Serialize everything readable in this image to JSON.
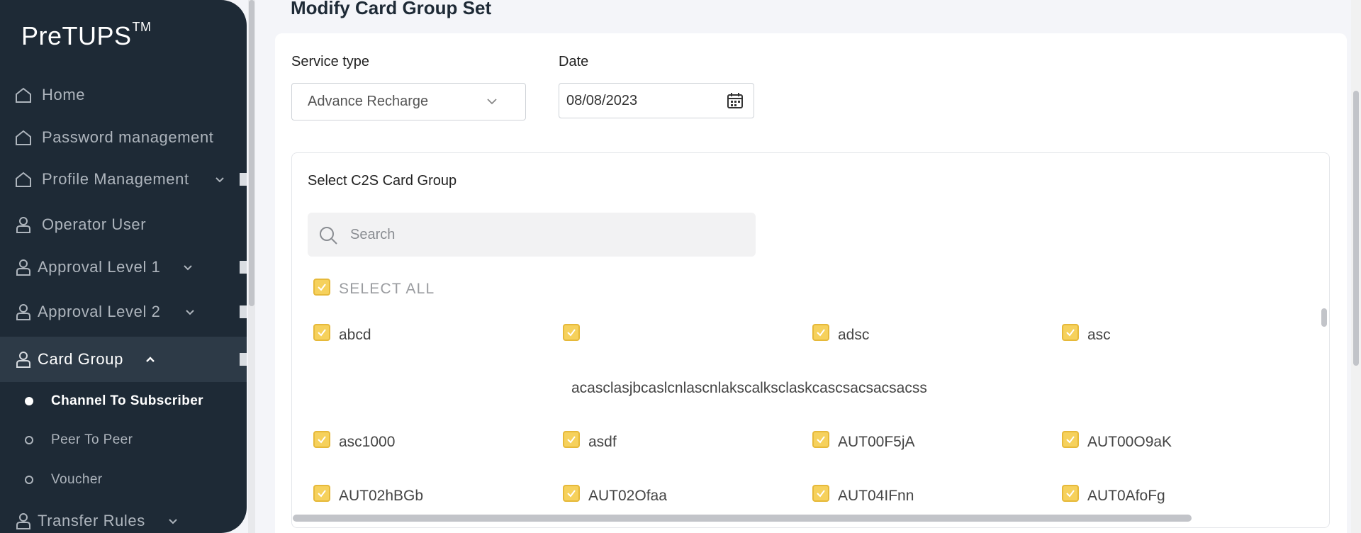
{
  "brand": {
    "name": "PreTUPS",
    "trademark": "TM"
  },
  "sidebar": {
    "items": [
      {
        "label": "Home",
        "icon": "home-icon"
      },
      {
        "label": "Password management",
        "icon": "home-icon"
      },
      {
        "label": "Profile Management",
        "icon": "home-icon"
      },
      {
        "label": "Operator User",
        "icon": "user-icon"
      },
      {
        "label": "Approval Level 1",
        "icon": "user-icon"
      },
      {
        "label": "Approval Level 2",
        "icon": "user-icon"
      },
      {
        "label": "Card Group",
        "icon": "user-icon"
      },
      {
        "label": "Transfer Rules",
        "icon": "user-icon"
      }
    ],
    "sub_items": [
      {
        "label": "Channel To Subscriber"
      },
      {
        "label": "Peer To Peer"
      },
      {
        "label": "Voucher"
      }
    ]
  },
  "page": {
    "title": "Modify Card Group Set"
  },
  "form": {
    "service_type_label": "Service type",
    "service_type_value": "Advance Recharge",
    "date_label": "Date",
    "date_value": "08/08/2023"
  },
  "card_group": {
    "title": "Select C2S Card Group",
    "search_placeholder": "Search",
    "select_all_label": "SELECT ALL",
    "items": [
      "abcd",
      "acasclasjbcaslcnlascnlakscalksclaskcascsacsacsacss",
      "adsc",
      "asc",
      "asc1000",
      "asdf",
      "AUT00F5jA",
      "AUT00O9aK",
      "AUT02hBGb",
      "AUT02Ofaa",
      "AUT04IFnn",
      "AUT0AfoFg"
    ]
  },
  "colors": {
    "sidebar_bg": "#1e2a36",
    "checkbox": "#f6d15c",
    "page_bg": "#f4f5f9"
  }
}
